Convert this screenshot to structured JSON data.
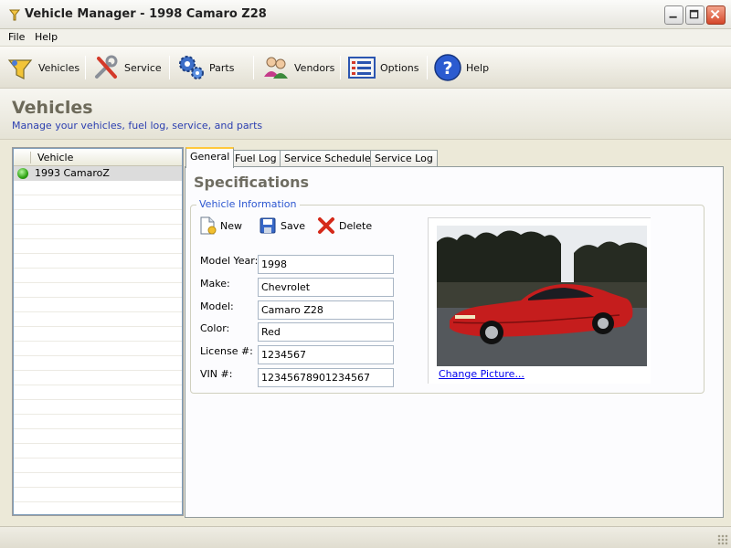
{
  "window": {
    "title": "Vehicle Manager - 1998 Camaro Z28"
  },
  "menu": {
    "items": [
      "File",
      "Help"
    ]
  },
  "toolbar": {
    "items": [
      {
        "label": "Vehicles",
        "icon": "vehicles-icon"
      },
      {
        "label": "Service",
        "icon": "wrench-screwdriver-icon"
      },
      {
        "label": "Parts",
        "icon": "gears-icon"
      },
      {
        "label": "Vendors",
        "icon": "people-icon"
      },
      {
        "label": "Options",
        "icon": "options-list-icon"
      },
      {
        "label": "Help",
        "icon": "help-icon"
      }
    ]
  },
  "header": {
    "title": "Vehicles",
    "subtitle": "Manage your vehicles, fuel log, service, and parts"
  },
  "vehicle_list": {
    "column_header": "Vehicle",
    "rows": [
      {
        "label": "1993 CamaroZ",
        "status_color": "#2ea212"
      }
    ]
  },
  "tabs": [
    "General",
    "Fuel Log",
    "Service Schedule",
    "Service Log"
  ],
  "active_tab": "General",
  "specifications": {
    "title": "Specifications",
    "group_label": "Vehicle Information",
    "actions": {
      "new": "New",
      "save": "Save",
      "delete": "Delete"
    },
    "fields": [
      {
        "label": "Model Year:",
        "value": "1998"
      },
      {
        "label": "Make:",
        "value": "Chevrolet"
      },
      {
        "label": "Model:",
        "value": "Camaro Z28"
      },
      {
        "label": "Color:",
        "value": "Red"
      },
      {
        "label": "License #:",
        "value": "1234567"
      },
      {
        "label": "VIN #:",
        "value": "12345678901234567"
      }
    ],
    "picture": {
      "link_text": "Change Picture..."
    }
  },
  "colors": {
    "accent_link": "#0000ee",
    "group_label": "#2c56d0",
    "subtitle": "#2c3fb0",
    "tab_highlight": "#ffc83c"
  }
}
